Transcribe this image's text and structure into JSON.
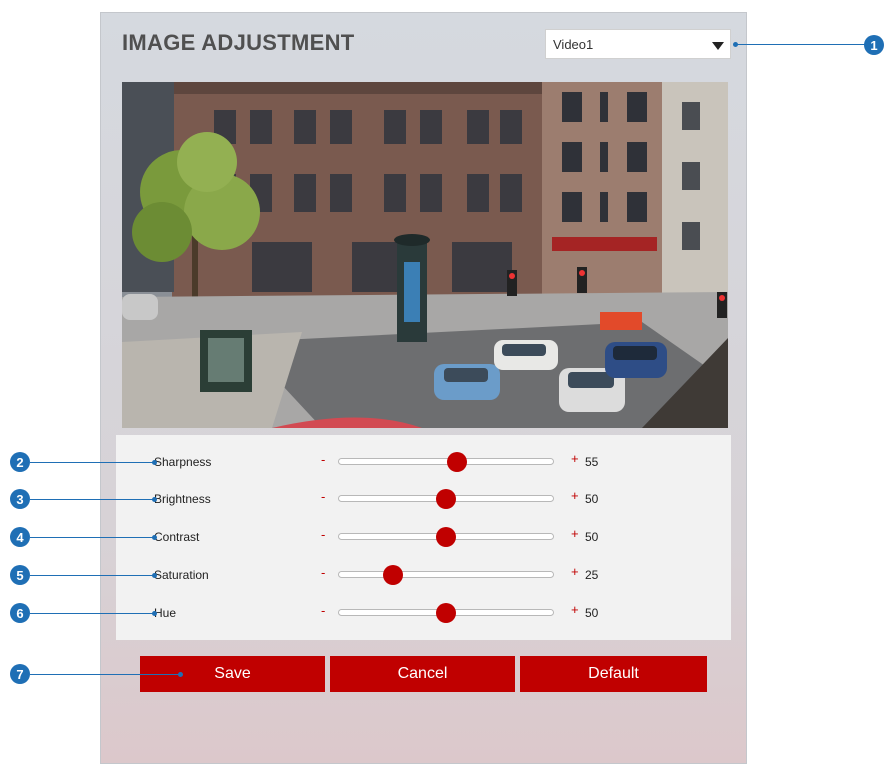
{
  "title": "IMAGE ADJUSTMENT",
  "stream_select": {
    "value": "Video1",
    "icon": "triangle-down"
  },
  "sliders": [
    {
      "label": "Sharpness",
      "minus": "-",
      "plus": "+",
      "value": "55",
      "level": 55
    },
    {
      "label": "Brightness",
      "minus": "-",
      "plus": "+",
      "value": "50",
      "level": 50
    },
    {
      "label": "Contrast",
      "minus": "-",
      "plus": "+",
      "value": "50",
      "level": 50
    },
    {
      "label": "Saturation",
      "minus": "-",
      "plus": "+",
      "value": "25",
      "level": 25
    },
    {
      "label": "Hue",
      "minus": "-",
      "plus": "+",
      "value": "50",
      "level": 50
    }
  ],
  "buttons": {
    "save": "Save",
    "cancel": "Cancel",
    "default": "Default"
  },
  "callouts": [
    "1",
    "2",
    "3",
    "4",
    "5",
    "6",
    "7"
  ],
  "colors": {
    "accent": "#c00000",
    "callout": "#1f6fb5"
  }
}
